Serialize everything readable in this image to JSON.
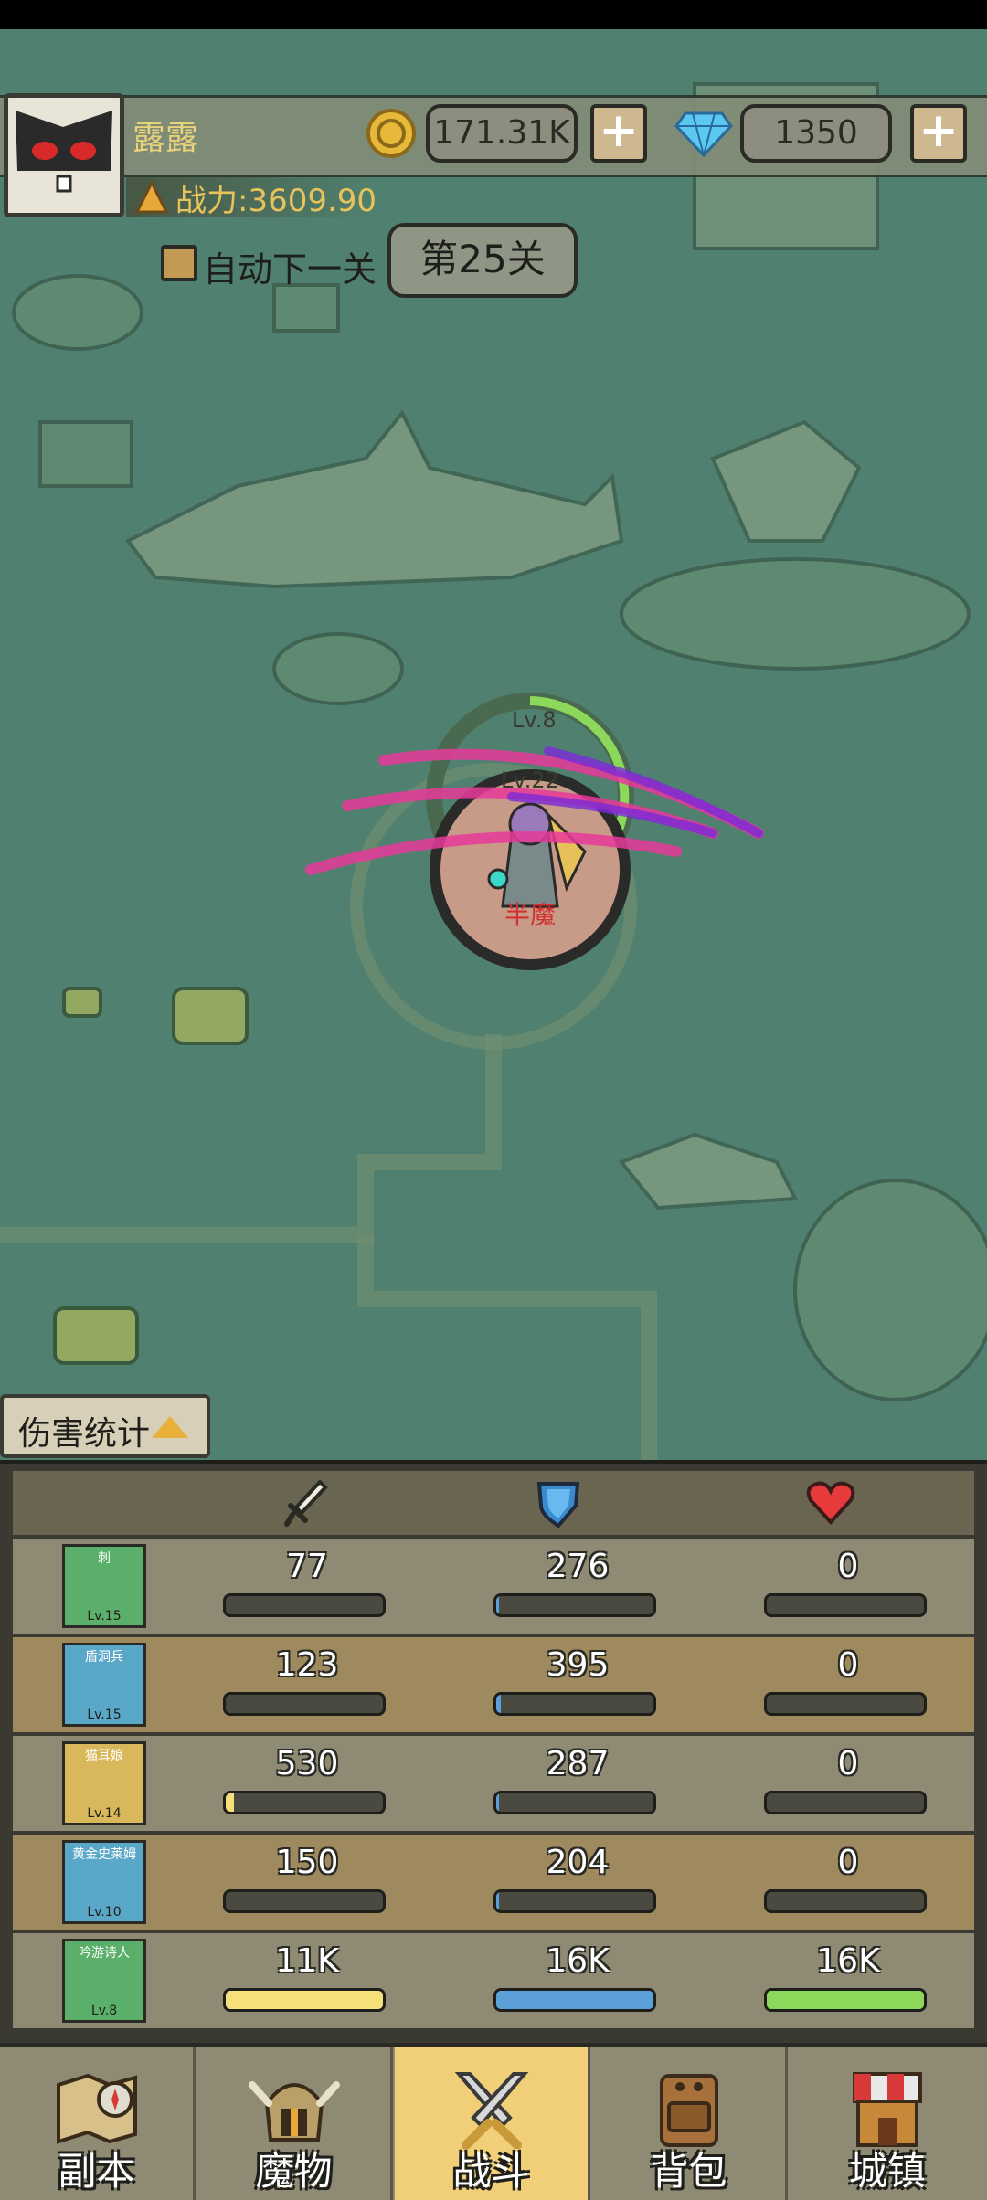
{
  "player": {
    "name": "露露",
    "power": "战力:3609.90"
  },
  "resources": {
    "gold": "171.31K",
    "gems": "1350",
    "plus": "+"
  },
  "stage": {
    "auto_next": "自动下一关",
    "current": "第25关"
  },
  "battle": {
    "ally_level": "Lv.8",
    "enemy_level": "Lv.22",
    "enemy_name": "半魔"
  },
  "damage_stats": {
    "tab_label": "伤害统计",
    "columns": [
      "sword-icon",
      "shield-icon",
      "heart-icon"
    ],
    "colors": {
      "attack": "#f5e07a",
      "defense": "#5ba0d8",
      "heal": "#8cd85a"
    },
    "rows": [
      {
        "name": "刺",
        "level": "Lv.15",
        "attack": "77",
        "defense": "276",
        "heal": "0",
        "attack_fill": 0.0,
        "defense_fill": 0.02,
        "heal_fill": 0.0
      },
      {
        "name": "盾洞兵",
        "level": "Lv.15",
        "attack": "123",
        "defense": "395",
        "heal": "0",
        "attack_fill": 0.0,
        "defense_fill": 0.03,
        "heal_fill": 0.0
      },
      {
        "name": "猫耳娘",
        "level": "Lv.14",
        "attack": "530",
        "defense": "287",
        "heal": "0",
        "attack_fill": 0.05,
        "defense_fill": 0.02,
        "heal_fill": 0.0
      },
      {
        "name": "黄金史莱姆",
        "level": "Lv.10",
        "attack": "150",
        "defense": "204",
        "heal": "0",
        "attack_fill": 0.0,
        "defense_fill": 0.02,
        "heal_fill": 0.0
      },
      {
        "name": "吟游诗人",
        "level": "Lv.8",
        "attack": "11K",
        "defense": "16K",
        "heal": "16K",
        "attack_fill": 1.0,
        "defense_fill": 1.0,
        "heal_fill": 1.0
      }
    ]
  },
  "nav": [
    {
      "label": "副本",
      "icon": "map-icon"
    },
    {
      "label": "魔物",
      "icon": "monster-helmet-icon"
    },
    {
      "label": "战斗",
      "icon": "crossed-swords-icon",
      "active": true
    },
    {
      "label": "背包",
      "icon": "backpack-icon"
    },
    {
      "label": "城镇",
      "icon": "shop-icon"
    }
  ]
}
